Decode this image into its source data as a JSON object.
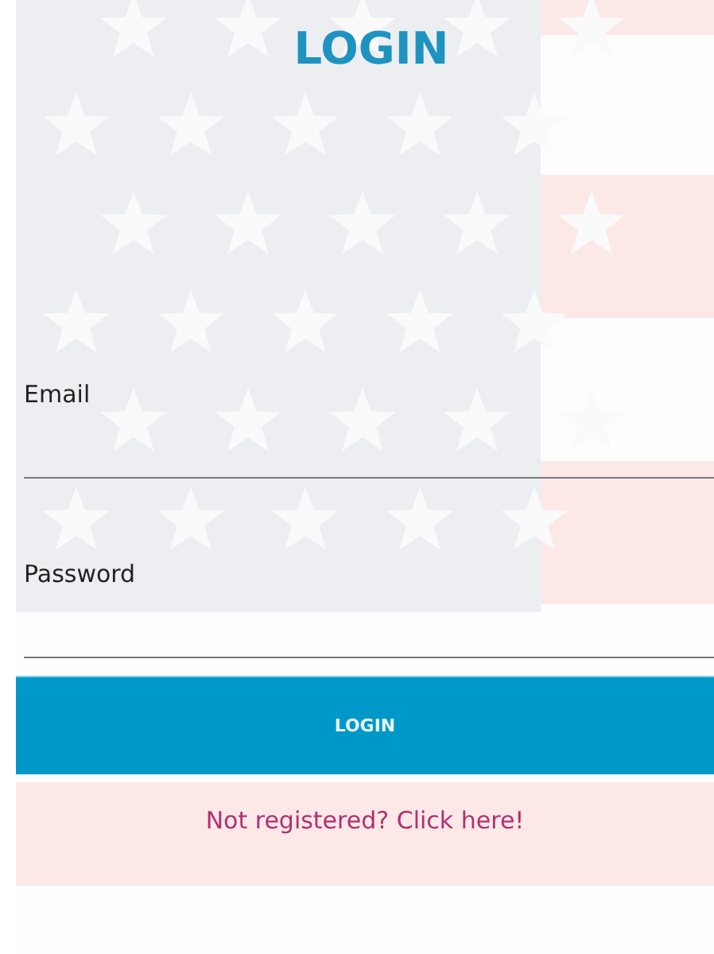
{
  "title": "LOGIN",
  "fields": [
    {
      "label": "Email"
    },
    {
      "label": "Password"
    }
  ],
  "button": {
    "label": "LOGIN"
  },
  "register_link": "Not registered? Click here!"
}
